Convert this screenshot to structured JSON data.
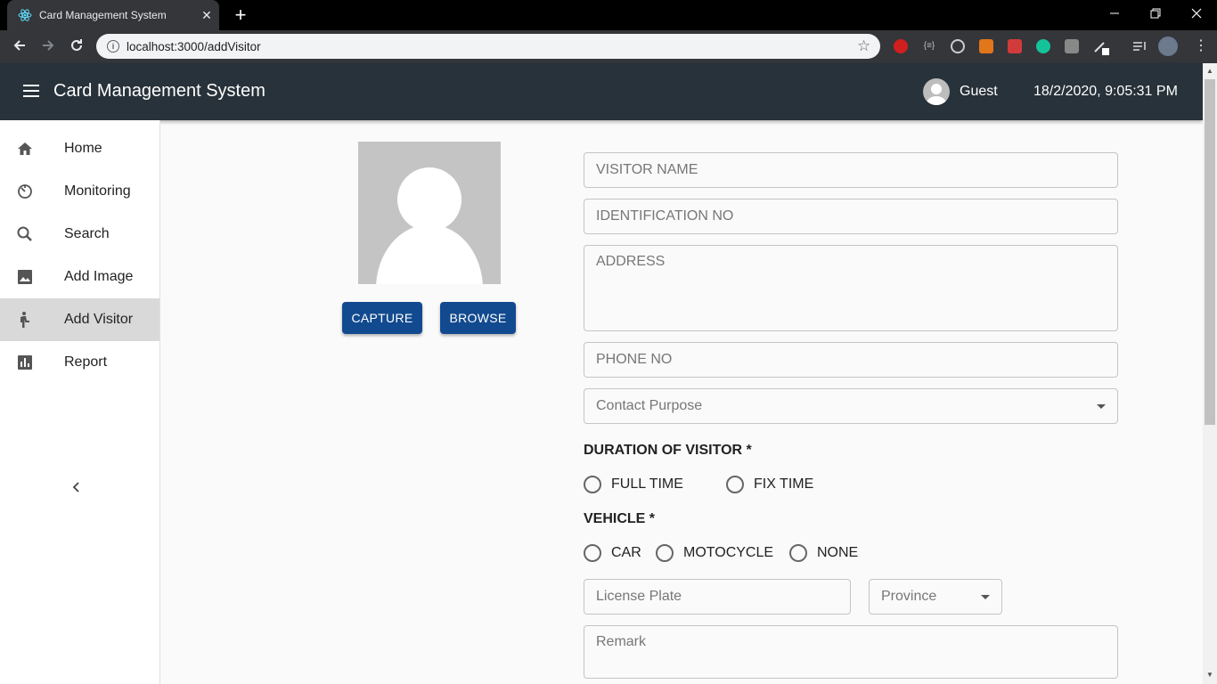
{
  "browser": {
    "tab_title": "Card Management System",
    "url": "localhost:3000/addVisitor",
    "close_symbol": "✕",
    "new_tab_symbol": "+"
  },
  "appbar": {
    "title": "Card Management System",
    "user": "Guest",
    "datetime": "18/2/2020, 9:05:31 PM"
  },
  "sidebar": {
    "items": [
      {
        "label": "Home",
        "icon": "home-icon"
      },
      {
        "label": "Monitoring",
        "icon": "timer-icon"
      },
      {
        "label": "Search",
        "icon": "search-icon"
      },
      {
        "label": "Add Image",
        "icon": "image-icon"
      },
      {
        "label": "Add Visitor",
        "icon": "person-walking-icon",
        "active": true
      },
      {
        "label": "Report",
        "icon": "bar-chart-icon"
      }
    ]
  },
  "photo": {
    "capture_label": "CAPTURE",
    "browse_label": "BROWSE"
  },
  "form": {
    "visitor_name_placeholder": "VISITOR NAME",
    "identification_placeholder": "IDENTIFICATION NO",
    "address_placeholder": "ADDRESS",
    "phone_placeholder": "PHONE NO",
    "contact_purpose_label": "Contact Purpose",
    "duration_label": "DURATION OF VISITOR *",
    "duration_options": [
      "FULL TIME",
      "FIX TIME"
    ],
    "vehicle_label": "VEHICLE *",
    "vehicle_options": [
      "CAR",
      "MOTOCYCLE",
      "NONE"
    ],
    "license_plate_placeholder": "License Plate",
    "province_label": "Province",
    "remark_placeholder": "Remark"
  },
  "colors": {
    "appbar_bg": "#27323a",
    "button_bg": "#124a8f",
    "active_item_bg": "#d9d9d9"
  }
}
